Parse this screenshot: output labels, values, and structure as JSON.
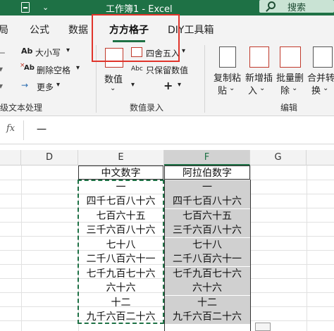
{
  "titlebar": {
    "title": "工作簿1  -  Excel",
    "search_label": "搜索",
    "dropdown_glyph": "⌄"
  },
  "tabs": [
    {
      "label": "局"
    },
    {
      "label": "公式"
    },
    {
      "label": "数据"
    },
    {
      "label": "方方格子",
      "active": true
    },
    {
      "label": "DIY工具箱"
    }
  ],
  "ribbon": {
    "text_group": {
      "size_btn": "大小写",
      "delete_space_btn": "删除空格",
      "more_btn": "更多",
      "label": "级文本处理"
    },
    "number_group": {
      "value_btn": "数值",
      "round_btn": "四舍五入",
      "keep_value_btn": "只保留数值",
      "label": "数值录入"
    },
    "edit_group": {
      "copy_paste_line1": "复制粘",
      "copy_paste_line2": "贴",
      "insert_line1": "新增插",
      "insert_line2": "入",
      "batch_delete_line1": "批量删",
      "batch_delete_line2": "除",
      "merge_line1": "合并转",
      "merge_line2": "换",
      "label": "编辑"
    },
    "icon_glyphs": {
      "ab_icon": "Ab",
      "abc_icon": "Abc",
      "times_glyph": "×",
      "plus_glyph": "+",
      "minus_glyph": "−",
      "chevron_glyph": "⌄",
      "caret_glyph": "▾",
      "arrow_glyph": "→"
    }
  },
  "formula_bar": {
    "fx_label": "fx",
    "value": "一"
  },
  "columns": [
    {
      "label": "D"
    },
    {
      "label": "E"
    },
    {
      "label": "F",
      "selected": true
    },
    {
      "label": "G"
    }
  ],
  "table": {
    "header_e": "中文数字",
    "header_f": "阿拉伯数字",
    "rows": [
      {
        "e": "一",
        "f": "一"
      },
      {
        "e": "四千七百八十六",
        "f": "四千七百八十六"
      },
      {
        "e": "七百六十五",
        "f": "七百六十五"
      },
      {
        "e": "三千六百八十六",
        "f": "三千六百八十六"
      },
      {
        "e": "七十八",
        "f": "七十八"
      },
      {
        "e": "二千八百六十一",
        "f": "二千八百六十一"
      },
      {
        "e": "七千九百七十六",
        "f": "七千九百七十六"
      },
      {
        "e": "六十六",
        "f": "六十六"
      },
      {
        "e": "十二",
        "f": "十二"
      },
      {
        "e": "九千六百二十六",
        "f": "九千六百二十六"
      }
    ]
  },
  "colors": {
    "excel_green": "#1e7145",
    "highlight_red": "#e0342b",
    "selected_fill": "#d0d0d0"
  }
}
